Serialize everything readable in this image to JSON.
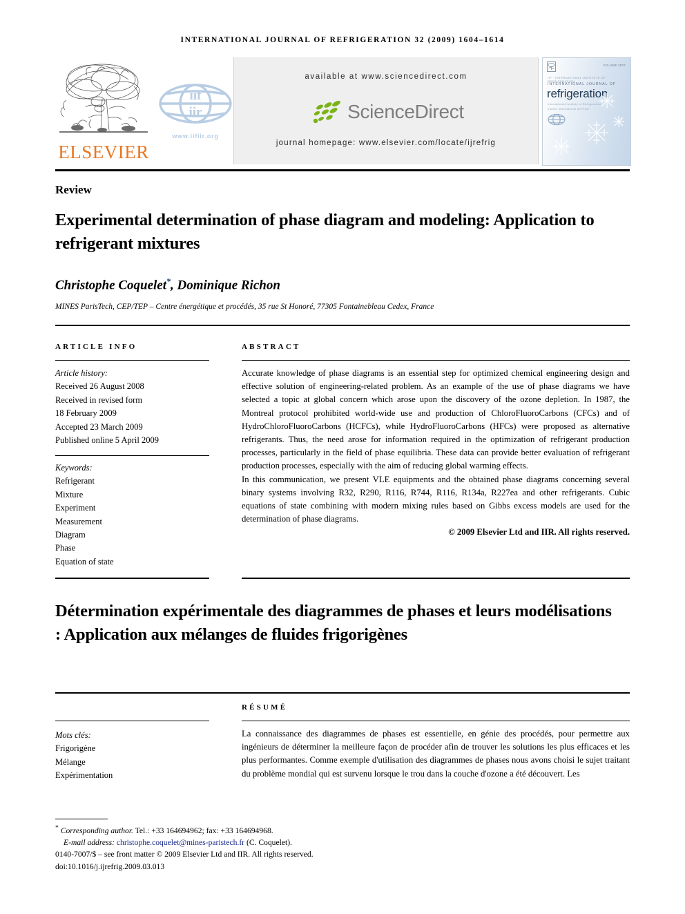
{
  "running_head": "International Journal of Refrigeration 32 (2009) 1604–1614",
  "masthead": {
    "elsevier_wordmark": "ELSEVIER",
    "iif_url": "www.iifiir.org",
    "sciencedirect": {
      "available_at": "available at www.sciencedirect.com",
      "wordmark": "ScienceDirect",
      "journal_homepage": "journal homepage: www.elsevier.com/locate/ijrefrig"
    },
    "cover": {
      "issue_label": "VOLUME 2007",
      "society_line": "IIF · INTERNATIONAL INSTITUTE OF REFRIGERATION",
      "kicker": "INTERNATIONAL JOURNAL OF",
      "title": "refrigeration",
      "sub_line_1": "International Institute of Refrigeration",
      "sub_line_2": "Institut International du Froid"
    }
  },
  "doc_type": "Review",
  "title": "Experimental determination of phase diagram and modeling: Application to refrigerant mixtures",
  "authors": "Christophe Coquelet",
  "authors_marker": "*",
  "authors_rest": ", Dominique Richon",
  "affiliation": "MINES ParisTech, CEP/TEP – Centre énergétique et procédés, 35 rue St Honoré, 77305 Fontainebleau Cedex, France",
  "article_info": {
    "heading": "Article info",
    "history_label": "Article history:",
    "history": [
      "Received 26 August 2008",
      "Received in revised form",
      "18 February 2009",
      "Accepted 23 March 2009",
      "Published online 5 April 2009"
    ],
    "keywords_label": "Keywords:",
    "keywords": [
      "Refrigerant",
      "Mixture",
      "Experiment",
      "Measurement",
      "Diagram",
      "Phase",
      "Equation of state"
    ]
  },
  "abstract": {
    "heading": "Abstract",
    "paragraphs": [
      "Accurate knowledge of phase diagrams is an essential step for optimized chemical engineering design and effective solution of engineering-related problem. As an example of the use of phase diagrams we have selected a topic at global concern which arose upon the discovery of the ozone depletion. In 1987, the Montreal protocol prohibited world-wide use and production of ChloroFluoroCarbons (CFCs) and of HydroChloroFluoroCarbons (HCFCs), while HydroFluoroCarbons (HFCs) were proposed as alternative refrigerants. Thus, the need arose for information required in the optimization of refrigerant production processes, particularly in the field of phase equilibria. These data can provide better evaluation of refrigerant production processes, especially with the aim of reducing global warming effects.",
      "In this communication, we present VLE equipments and the obtained phase diagrams concerning several binary systems involving R32, R290, R116, R744, R116, R134a, R227ea and other refrigerants. Cubic equations of state combining with modern mixing rules based on Gibbs excess models are used for the determination of phase diagrams."
    ],
    "copyright": "© 2009 Elsevier Ltd and IIR. All rights reserved."
  },
  "french": {
    "title": "Détermination expérimentale des diagrammes de phases et leurs modélisations : Application aux mélanges de fluides frigorigènes",
    "keywords_label": "Mots clés:",
    "keywords": [
      "Frigorigène",
      "Mélange",
      "Expérimentation"
    ],
    "resume_heading": "Résumé",
    "resume_text": "La connaissance des diagrammes de phases est essentielle, en génie des procédés, pour permettre aux ingénieurs de déterminer la meilleure façon de procéder afin de trouver les solutions les plus efficaces et les plus performantes. Comme exemple d'utilisation des diagrammes de phases nous avons choisi le sujet traitant du problème mondial qui est survenu lorsque le trou dans la couche d'ozone a été découvert. Les"
  },
  "footer": {
    "corresponding_marker": "*",
    "corresponding_label": "Corresponding author.",
    "corresponding_contact": " Tel.: +33 164694962; fax: +33 164694968.",
    "email_label": "E-mail address:",
    "email": "christophe.coquelet@mines-paristech.fr",
    "email_owner": "(C. Coquelet).",
    "issn_line": "0140-7007/$ – see front matter © 2009 Elsevier Ltd and IIR. All rights reserved.",
    "doi_line": "doi:10.1016/j.ijrefrig.2009.03.013"
  },
  "colors": {
    "elsevier_orange": "#e87722",
    "sciencedirect_green": "#7ab317",
    "sciencedirect_gray": "#7d7d7d",
    "iif_blue": "#b8cde4",
    "link_blue": "#182987",
    "banner_gray": "#efefef"
  }
}
